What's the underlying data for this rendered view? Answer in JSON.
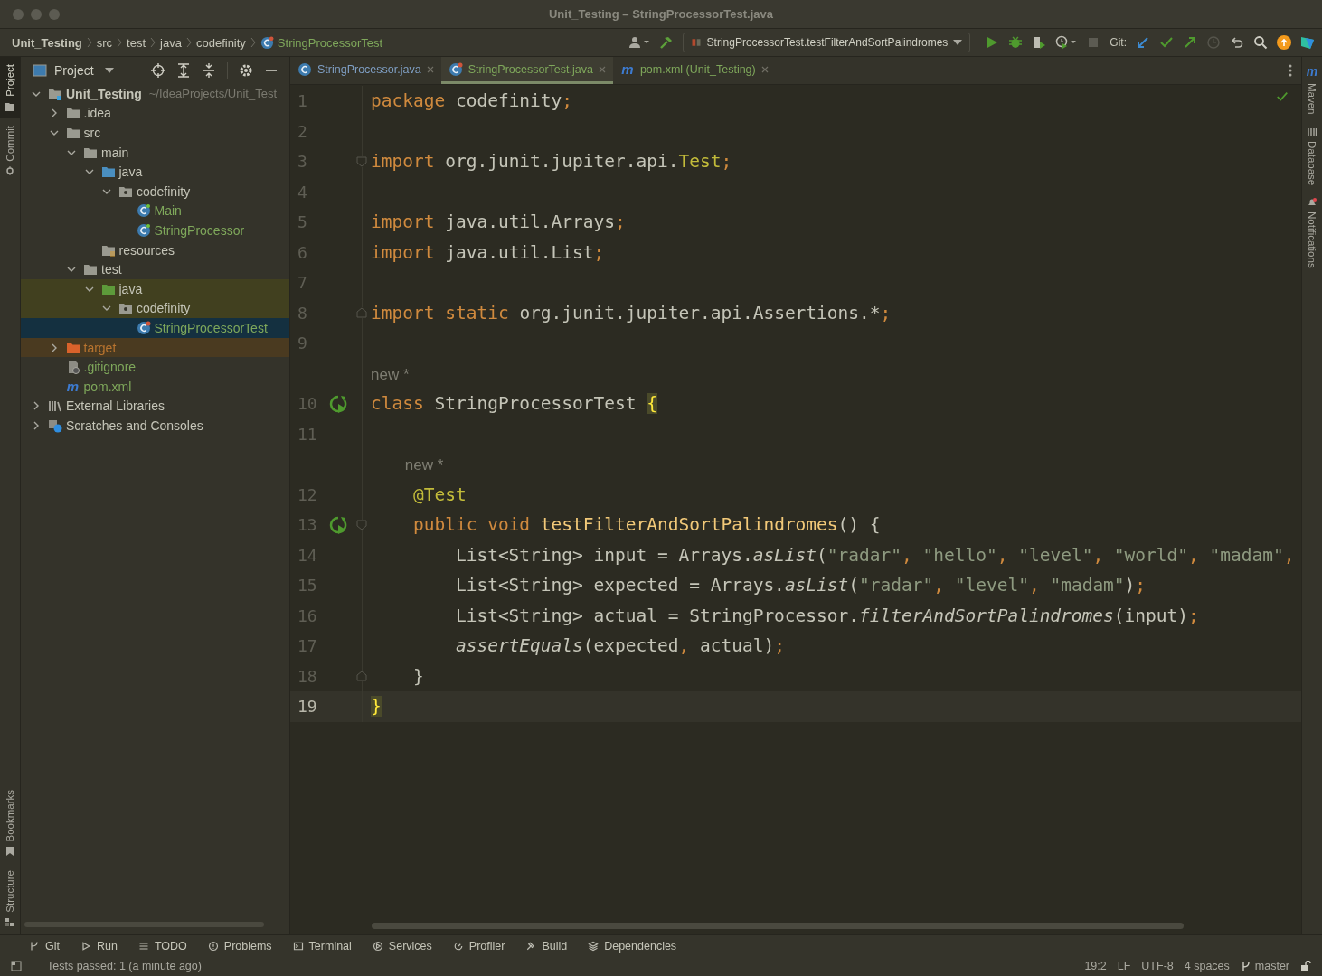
{
  "window": {
    "title": "Unit_Testing – StringProcessorTest.java"
  },
  "breadcrumbs": [
    {
      "label": "Unit_Testing",
      "kind": "project"
    },
    {
      "label": "src",
      "kind": "dir"
    },
    {
      "label": "test",
      "kind": "dir"
    },
    {
      "label": "java",
      "kind": "dir"
    },
    {
      "label": "codefinity",
      "kind": "dir"
    },
    {
      "label": "StringProcessorTest",
      "kind": "class"
    }
  ],
  "toolbar": {
    "run_config": "StringProcessorTest.testFilterAndSortPalindromes",
    "git_label": "Git:"
  },
  "left_stripe": {
    "top": [
      {
        "label": "Project",
        "selected": true,
        "kind": "project"
      },
      {
        "label": "Commit",
        "selected": false,
        "kind": "commit"
      }
    ],
    "bottom": [
      {
        "label": "Bookmarks",
        "selected": false,
        "kind": "bookmarks"
      },
      {
        "label": "Structure",
        "selected": false,
        "kind": "structure"
      }
    ]
  },
  "project_panel": {
    "title": "Project",
    "tree": [
      {
        "label": "Unit_Testing",
        "kind": "project",
        "path": "~/IdeaProjects/Unit_Test",
        "expanded": true,
        "children": [
          {
            "label": ".idea",
            "kind": "folder",
            "expanded": false
          },
          {
            "label": "src",
            "kind": "folder",
            "expanded": true,
            "children": [
              {
                "label": "main",
                "kind": "folder",
                "expanded": true,
                "children": [
                  {
                    "label": "java",
                    "kind": "source",
                    "expanded": true,
                    "children": [
                      {
                        "label": "codefinity",
                        "kind": "package",
                        "expanded": true,
                        "children": [
                          {
                            "label": "Main",
                            "kind": "class",
                            "color": "#7fa85b",
                            "selected": false
                          },
                          {
                            "label": "StringProcessor",
                            "kind": "class",
                            "color": "#7fa85b",
                            "selected": false
                          }
                        ]
                      }
                    ]
                  },
                  {
                    "label": "resources",
                    "kind": "resources"
                  }
                ]
              },
              {
                "label": "test",
                "kind": "folder",
                "expanded": true,
                "children": [
                  {
                    "label": "java",
                    "kind": "test",
                    "expanded": true,
                    "children": [
                      {
                        "label": "codefinity",
                        "kind": "package",
                        "expanded": true,
                        "children": [
                          {
                            "label": "StringProcessorTest",
                            "kind": "testclass",
                            "color": "#7fa85b",
                            "selected": true
                          }
                        ]
                      }
                    ]
                  }
                ]
              }
            ]
          },
          {
            "label": "target",
            "kind": "excluded",
            "color": "#b8742f",
            "expanded": false
          },
          {
            "label": ".gitignore",
            "kind": "gitignore",
            "color": "#7fa85b"
          },
          {
            "label": "pom.xml",
            "kind": "maven",
            "color": "#7fa85b",
            "glyph": "m"
          }
        ]
      },
      {
        "label": "External Libraries",
        "kind": "libraries",
        "expanded": false
      },
      {
        "label": "Scratches and Consoles",
        "kind": "scratches",
        "expanded": false
      }
    ]
  },
  "tabs": [
    {
      "label": "StringProcessor.java",
      "kind": "class",
      "color": "#7f9fc4",
      "selected": false
    },
    {
      "label": "StringProcessorTest.java",
      "kind": "testclass",
      "color": "#7fa85b",
      "selected": true
    },
    {
      "label": "pom.xml (Unit_Testing)",
      "kind": "maven",
      "color": "#7fa85b",
      "selected": false,
      "glyph": "m"
    }
  ],
  "editor": {
    "rows": [
      {
        "kind": "code",
        "number": "1",
        "code": [
          {
            "t": "package",
            "kind": "kw"
          },
          {
            "t": " codefinity",
            "kind": "id"
          },
          {
            "t": ";",
            "kind": "semi"
          }
        ]
      },
      {
        "kind": "code",
        "number": "2",
        "code": []
      },
      {
        "kind": "code",
        "number": "3",
        "fold_start": true,
        "code": [
          {
            "t": "import",
            "kind": "kw"
          },
          {
            "t": " org.junit.jupiter.api.",
            "kind": "id"
          },
          {
            "t": "Test",
            "kind": "ann"
          },
          {
            "t": ";",
            "kind": "semi"
          }
        ]
      },
      {
        "kind": "code",
        "number": "4",
        "code": []
      },
      {
        "kind": "code",
        "number": "5",
        "code": [
          {
            "t": "import",
            "kind": "kw"
          },
          {
            "t": " java.util.Arrays",
            "kind": "id"
          },
          {
            "t": ";",
            "kind": "semi"
          }
        ]
      },
      {
        "kind": "code",
        "number": "6",
        "code": [
          {
            "t": "import",
            "kind": "kw"
          },
          {
            "t": " java.util.List",
            "kind": "id"
          },
          {
            "t": ";",
            "kind": "semi"
          }
        ]
      },
      {
        "kind": "code",
        "number": "7",
        "code": []
      },
      {
        "kind": "code",
        "number": "8",
        "fold_end": true,
        "code": [
          {
            "t": "import",
            "kind": "kw"
          },
          {
            "t": " static",
            "kind": "kw"
          },
          {
            "t": " org.junit.jupiter.api.Assertions.*",
            "kind": "id"
          },
          {
            "t": ";",
            "kind": "semi"
          }
        ]
      },
      {
        "kind": "code",
        "number": "9",
        "code": []
      },
      {
        "kind": "hint",
        "text": "new *"
      },
      {
        "kind": "code",
        "number": "10",
        "run": true,
        "code": [
          {
            "t": "class",
            "kind": "kw"
          },
          {
            "t": " StringProcessorTest ",
            "kind": "id"
          },
          {
            "t": "{",
            "kind": "brace"
          }
        ]
      },
      {
        "kind": "code",
        "number": "11",
        "code": []
      },
      {
        "kind": "hint",
        "text": "new *"
      },
      {
        "kind": "code",
        "number": "12",
        "code": [
          {
            "t": "    @Test",
            "kind": "ann"
          }
        ]
      },
      {
        "kind": "code",
        "number": "13",
        "run": true,
        "fold_start": true,
        "code": [
          {
            "t": "    public void",
            "kind": "kw"
          },
          {
            "t": " testFilterAndSortPalindromes",
            "kind": "fn"
          },
          {
            "t": "() {",
            "kind": "id"
          }
        ]
      },
      {
        "kind": "code",
        "number": "14",
        "code": [
          {
            "t": "        List<String> input = Arrays.",
            "kind": "id"
          },
          {
            "t": "asList",
            "kind": "static"
          },
          {
            "t": "(",
            "kind": "id"
          },
          {
            "t": "\"radar\"",
            "kind": "str"
          },
          {
            "t": ", ",
            "kind": "semi"
          },
          {
            "t": "\"hello\"",
            "kind": "str"
          },
          {
            "t": ", ",
            "kind": "semi"
          },
          {
            "t": "\"level\"",
            "kind": "str"
          },
          {
            "t": ", ",
            "kind": "semi"
          },
          {
            "t": "\"world\"",
            "kind": "str"
          },
          {
            "t": ", ",
            "kind": "semi"
          },
          {
            "t": "\"madam\"",
            "kind": "str"
          },
          {
            "t": ",",
            "kind": "semi"
          }
        ]
      },
      {
        "kind": "code",
        "number": "15",
        "code": [
          {
            "t": "        List<String> expected = Arrays.",
            "kind": "id"
          },
          {
            "t": "asList",
            "kind": "static"
          },
          {
            "t": "(",
            "kind": "id"
          },
          {
            "t": "\"radar\"",
            "kind": "str"
          },
          {
            "t": ", ",
            "kind": "semi"
          },
          {
            "t": "\"level\"",
            "kind": "str"
          },
          {
            "t": ", ",
            "kind": "semi"
          },
          {
            "t": "\"madam\"",
            "kind": "str"
          },
          {
            "t": ")",
            "kind": "id"
          },
          {
            "t": ";",
            "kind": "semi"
          }
        ]
      },
      {
        "kind": "code",
        "number": "16",
        "code": [
          {
            "t": "        List<String> actual = StringProcessor.",
            "kind": "id"
          },
          {
            "t": "filterAndSortPalindromes",
            "kind": "static"
          },
          {
            "t": "(input)",
            "kind": "id"
          },
          {
            "t": ";",
            "kind": "semi"
          }
        ]
      },
      {
        "kind": "code",
        "number": "17",
        "code": [
          {
            "t": "        assertEquals",
            "kind": "static"
          },
          {
            "t": "(expected",
            "kind": "id"
          },
          {
            "t": ", ",
            "kind": "semi"
          },
          {
            "t": "actual)",
            "kind": "id"
          },
          {
            "t": ";",
            "kind": "semi"
          }
        ]
      },
      {
        "kind": "code",
        "number": "18",
        "fold_end": true,
        "code": [
          {
            "t": "    }",
            "kind": "id"
          }
        ]
      },
      {
        "kind": "code",
        "number": "19",
        "current": true,
        "code": [
          {
            "t": "}",
            "kind": "brace"
          }
        ]
      }
    ]
  },
  "right_stripe": [
    {
      "label": "Maven",
      "kind": "maven",
      "glyph": "m"
    },
    {
      "label": "Database",
      "kind": "database"
    },
    {
      "label": "Notifications",
      "kind": "notifications"
    }
  ],
  "tool_windows": [
    {
      "label": "Git",
      "kind": "git"
    },
    {
      "label": "Run",
      "kind": "run"
    },
    {
      "label": "TODO",
      "kind": "todo"
    },
    {
      "label": "Problems",
      "kind": "problems"
    },
    {
      "label": "Terminal",
      "kind": "terminal"
    },
    {
      "label": "Services",
      "kind": "services"
    },
    {
      "label": "Profiler",
      "kind": "profiler"
    },
    {
      "label": "Build",
      "kind": "build"
    },
    {
      "label": "Dependencies",
      "kind": "dependencies"
    }
  ],
  "status_bar": {
    "message": "Tests passed: 1 (a minute ago)",
    "items": [
      {
        "label": "19:2",
        "kind": "text"
      },
      {
        "label": "LF",
        "kind": "text"
      },
      {
        "label": "UTF-8",
        "kind": "text"
      },
      {
        "label": "4 spaces",
        "kind": "text"
      },
      {
        "label": "master",
        "kind": "branch"
      }
    ]
  }
}
